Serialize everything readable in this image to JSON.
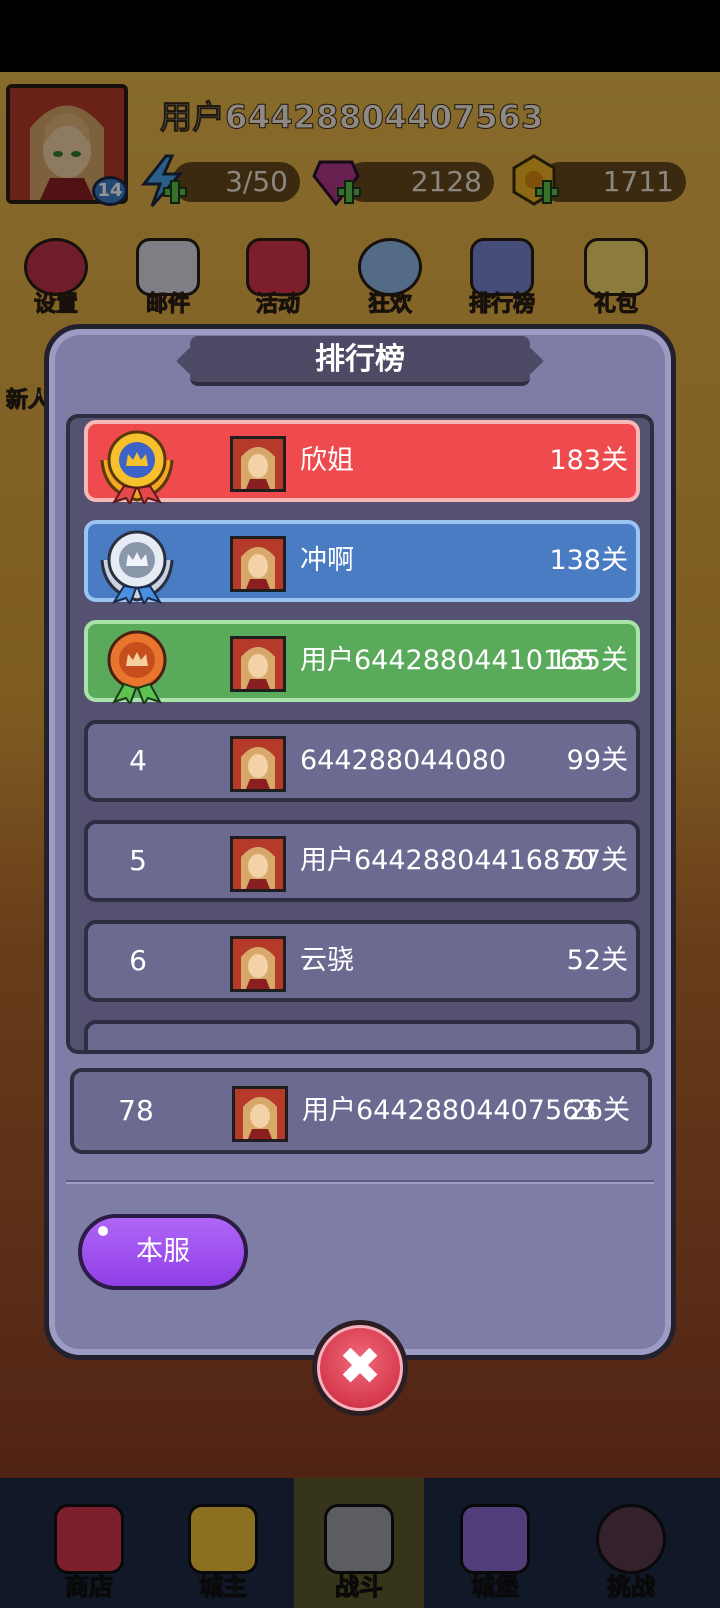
{
  "header": {
    "user_name": "用户64428804407563",
    "level": "14",
    "energy": "3/50",
    "gems": "2128",
    "gold": "1711"
  },
  "top_menu": [
    {
      "label": "设置",
      "icon": "gear-icon"
    },
    {
      "label": "邮件",
      "icon": "mail-icon"
    },
    {
      "label": "活动",
      "icon": "gift-box-icon"
    },
    {
      "label": "狂欢",
      "icon": "balloons-icon"
    },
    {
      "label": "排行榜",
      "icon": "bar-chart-icon"
    },
    {
      "label": "礼包",
      "icon": "present-icon"
    }
  ],
  "left_tab_label": "新人",
  "leaderboard": {
    "title": "排行榜",
    "rows": [
      {
        "rank": "1",
        "name": "欣姐",
        "score": "183关",
        "color": "#ef4a4d",
        "medal": "gold-medal-icon"
      },
      {
        "rank": "2",
        "name": "冲啊",
        "score": "138关",
        "color": "#4a7cc4",
        "medal": "silver-medal-icon"
      },
      {
        "rank": "3",
        "name": "用户64428804410165",
        "score": "135关",
        "color": "#5aaa5c",
        "medal": "bronze-medal-icon"
      },
      {
        "rank": "4",
        "name": "644288044080",
        "score": "99关",
        "color": "#6c6a90"
      },
      {
        "rank": "5",
        "name": "用户64428804416870",
        "score": "57关",
        "color": "#6c6a90"
      },
      {
        "rank": "6",
        "name": "云骁",
        "score": "52关",
        "color": "#6c6a90"
      }
    ],
    "my_rank": {
      "rank": "78",
      "name": "用户64428804407563",
      "score": "26关"
    },
    "server_button": "本服",
    "close_symbol": "✖"
  },
  "bottom_nav": [
    {
      "label": "商店",
      "icon": "shop-icon",
      "active": false
    },
    {
      "label": "城主",
      "icon": "crown-icon",
      "active": false
    },
    {
      "label": "战斗",
      "icon": "crossed-swords-icon",
      "active": true
    },
    {
      "label": "城堡",
      "icon": "castle-icon",
      "active": false
    },
    {
      "label": "挑战",
      "icon": "demon-icon",
      "active": false
    }
  ]
}
